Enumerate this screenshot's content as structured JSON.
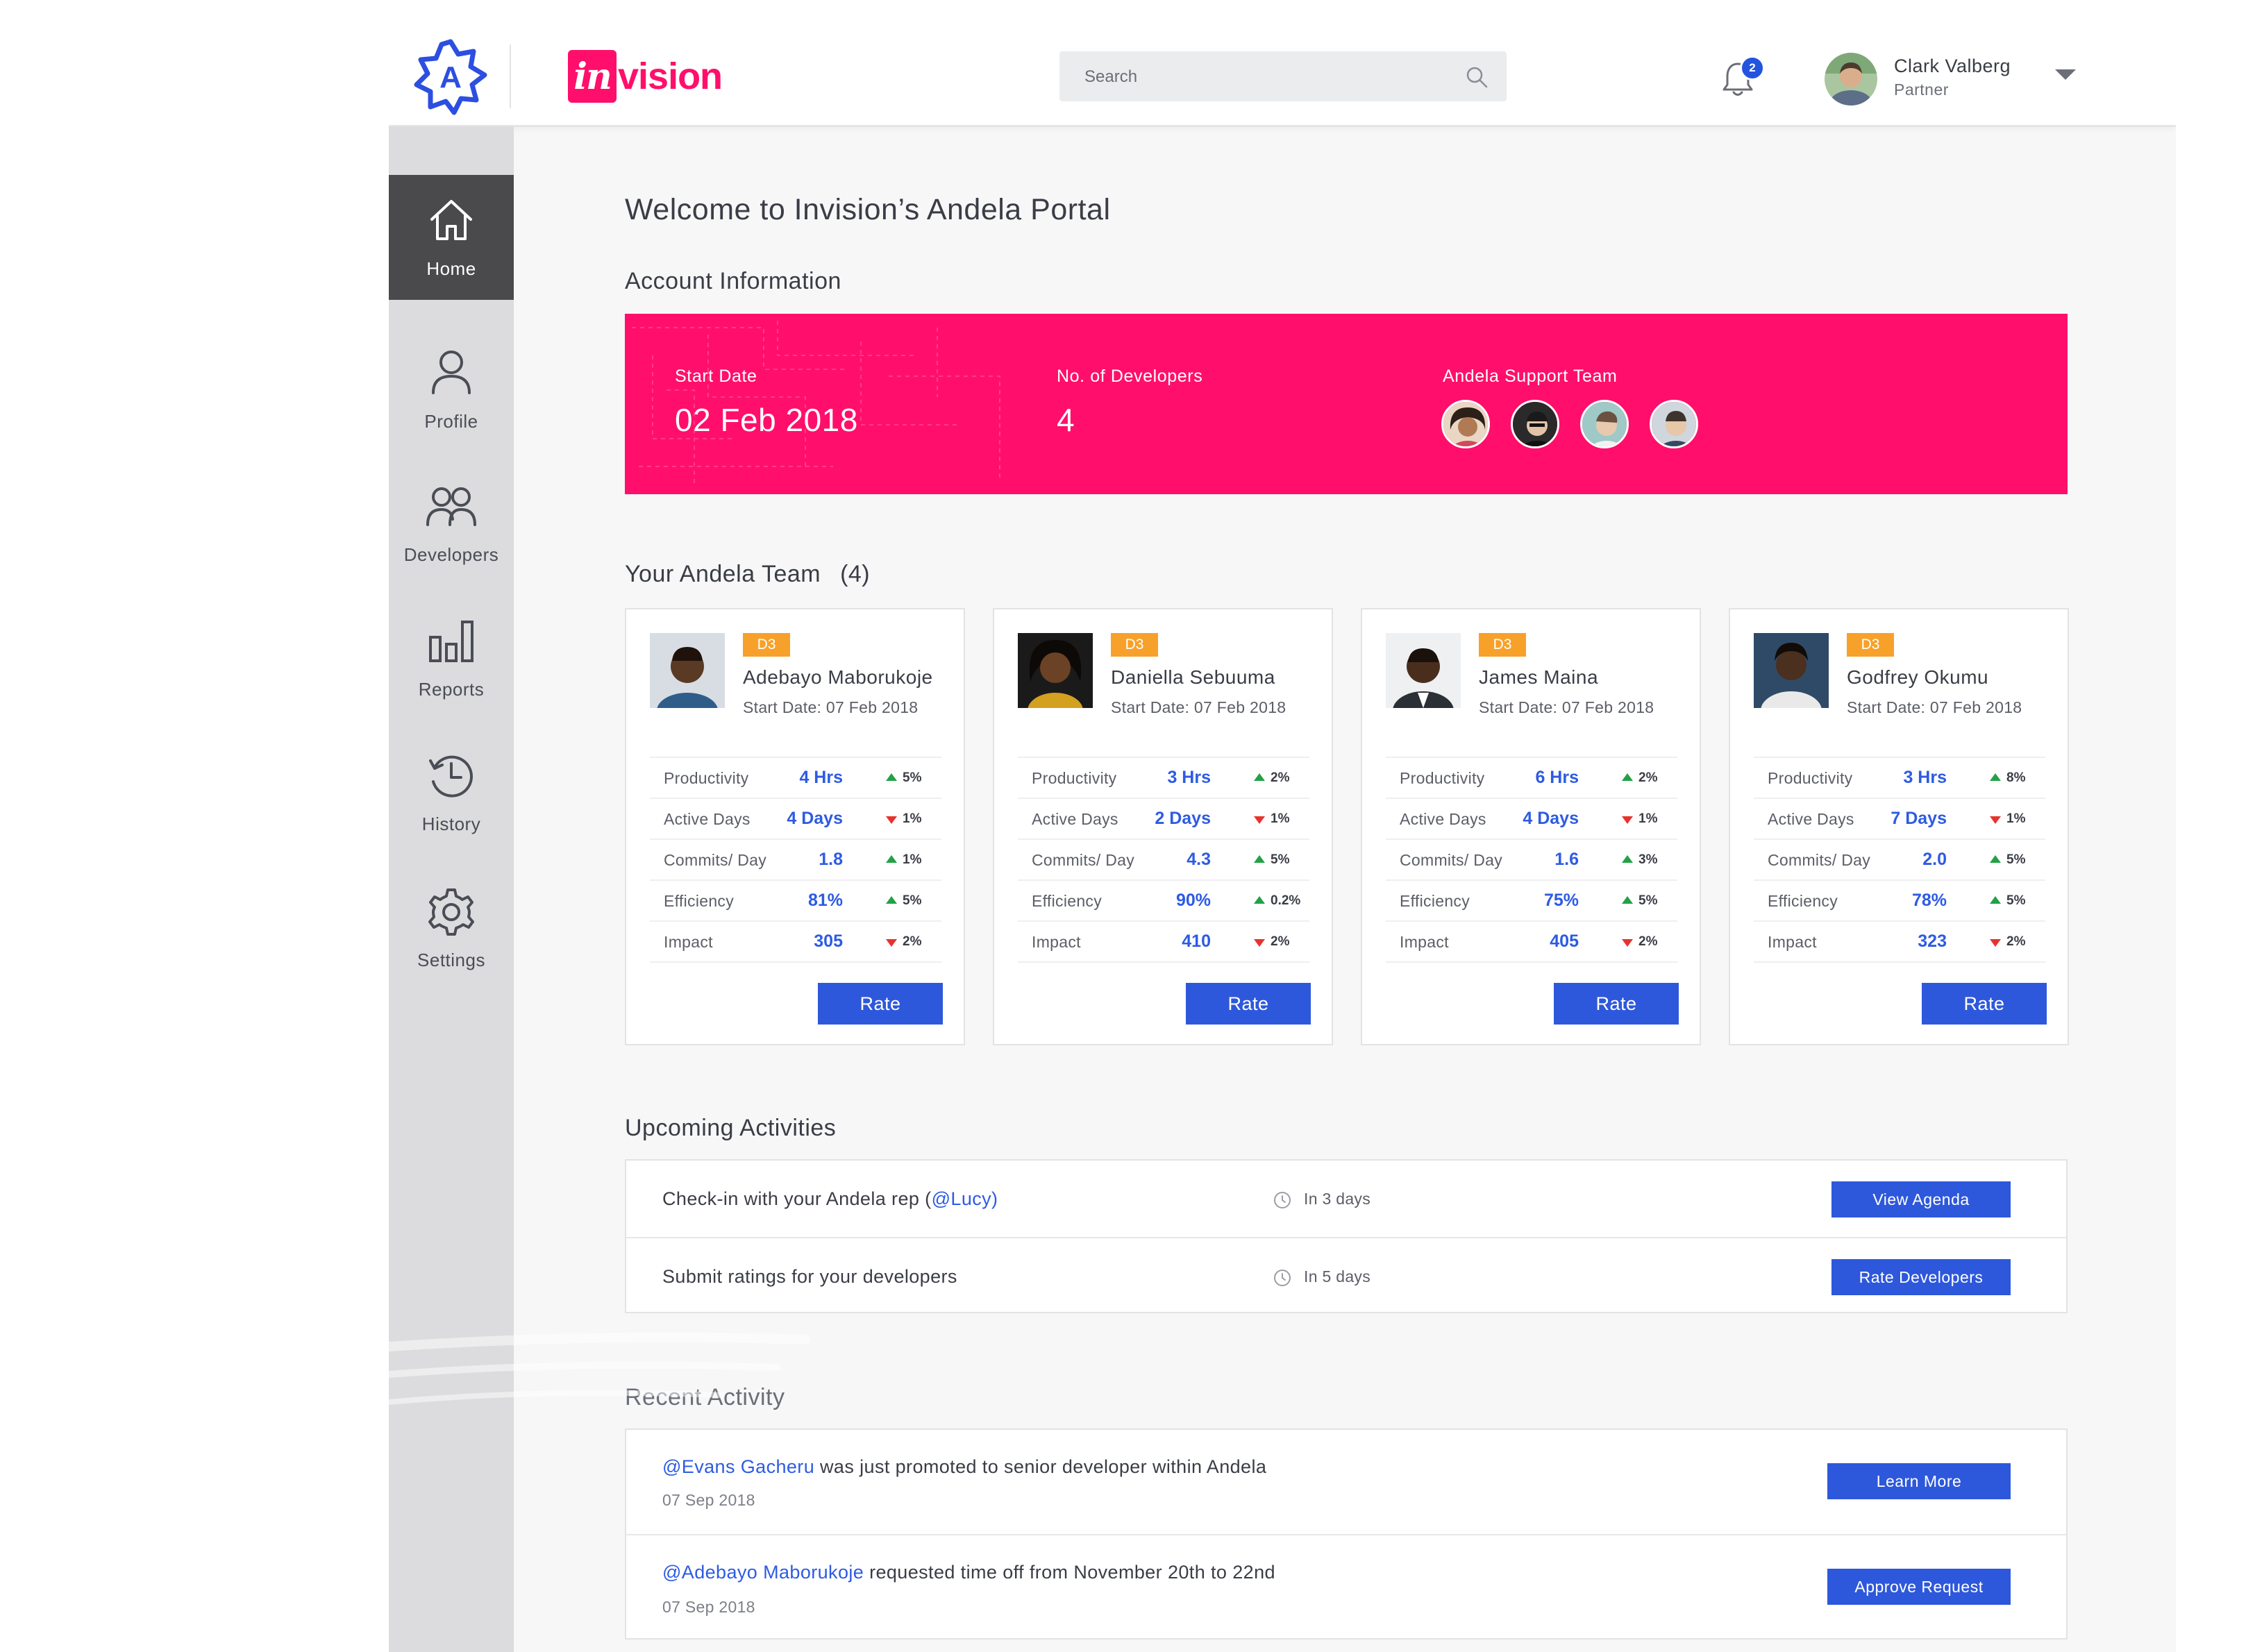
{
  "header": {
    "brand_logo_alt": "Andela",
    "partner_logo_main": "in",
    "partner_logo_rest": "vision",
    "search_placeholder": "Search",
    "notifications_count": "2",
    "user_name": "Clark Valberg",
    "user_role": "Partner"
  },
  "sidebar": {
    "items": [
      {
        "label": "Home",
        "icon": "home-icon",
        "active": true
      },
      {
        "label": "Profile",
        "icon": "profile-icon",
        "active": false
      },
      {
        "label": "Developers",
        "icon": "developers-icon",
        "active": false
      },
      {
        "label": "Reports",
        "icon": "reports-icon",
        "active": false
      },
      {
        "label": "History",
        "icon": "history-icon",
        "active": false
      },
      {
        "label": "Settings",
        "icon": "settings-icon",
        "active": false
      }
    ]
  },
  "main": {
    "welcome": "Welcome to Invision’s Andela Portal",
    "account_title": "Account Information",
    "account": {
      "start_date_label": "Start Date",
      "start_date": "02 Feb 2018",
      "developers_label": "No. of Developers",
      "developers_count": "4",
      "support_label": "Andela Support Team"
    },
    "team_title": "Your Andela Team",
    "team_count": "(4)",
    "metric_labels": [
      "Productivity",
      "Active Days",
      "Commits/ Day",
      "Efficiency",
      "Impact"
    ],
    "developers": [
      {
        "level": "D3",
        "name": "Adebayo Maborukoje",
        "start": "Start Date: 07 Feb 2018",
        "metrics": [
          {
            "value": "4 Hrs",
            "dir": "up",
            "change": "5%"
          },
          {
            "value": "4 Days",
            "dir": "down",
            "change": "1%"
          },
          {
            "value": "1.8",
            "dir": "up",
            "change": "1%"
          },
          {
            "value": "81%",
            "dir": "up",
            "change": "5%"
          },
          {
            "value": "305",
            "dir": "down",
            "change": "2%"
          }
        ],
        "rate_label": "Rate"
      },
      {
        "level": "D3",
        "name": "Daniella Sebuuma",
        "start": "Start Date: 07 Feb 2018",
        "metrics": [
          {
            "value": "3 Hrs",
            "dir": "up",
            "change": "2%"
          },
          {
            "value": "2 Days",
            "dir": "down",
            "change": "1%"
          },
          {
            "value": "4.3",
            "dir": "up",
            "change": "5%"
          },
          {
            "value": "90%",
            "dir": "up",
            "change": "0.2%"
          },
          {
            "value": "410",
            "dir": "down",
            "change": "2%"
          }
        ],
        "rate_label": "Rate"
      },
      {
        "level": "D3",
        "name": "James Maina",
        "start": "Start Date: 07 Feb 2018",
        "metrics": [
          {
            "value": "6 Hrs",
            "dir": "up",
            "change": "2%"
          },
          {
            "value": "4 Days",
            "dir": "down",
            "change": "1%"
          },
          {
            "value": "1.6",
            "dir": "up",
            "change": "3%"
          },
          {
            "value": "75%",
            "dir": "up",
            "change": "5%"
          },
          {
            "value": "405",
            "dir": "down",
            "change": "2%"
          }
        ],
        "rate_label": "Rate"
      },
      {
        "level": "D3",
        "name": "Godfrey Okumu",
        "start": "Start Date: 07 Feb 2018",
        "metrics": [
          {
            "value": "3 Hrs",
            "dir": "up",
            "change": "8%"
          },
          {
            "value": "7 Days",
            "dir": "down",
            "change": "1%"
          },
          {
            "value": "2.0",
            "dir": "up",
            "change": "5%"
          },
          {
            "value": "78%",
            "dir": "up",
            "change": "5%"
          },
          {
            "value": "323",
            "dir": "down",
            "change": "2%"
          }
        ],
        "rate_label": "Rate"
      }
    ],
    "upcoming_title": "Upcoming Activities",
    "upcoming": [
      {
        "text_before": "Check-in with your Andela rep (",
        "mention": "@Lucy",
        "text_after": ")",
        "when": "In 3 days",
        "button": "View Agenda"
      },
      {
        "text_before": "Submit ratings for your developers",
        "mention": "",
        "text_after": "",
        "when": "In 5 days",
        "button": "Rate Developers"
      }
    ],
    "recent_title": "Recent Activity",
    "recent": [
      {
        "mention": "@Evans Gacheru",
        "text": " was just promoted to senior developer within Andela",
        "date": "07 Sep 2018",
        "button": "Learn More"
      },
      {
        "mention": "@Adebayo Maborukoje",
        "text": " requested time off from November 20th to 22nd",
        "date": "07 Sep 2018",
        "button": "Approve Request"
      }
    ]
  },
  "colors": {
    "accent_pink": "#ff0f6b",
    "button_blue": "#2e58db",
    "link_blue": "#2d5be3",
    "badge_orange": "#f7a12b",
    "up_green": "#22a146",
    "down_red": "#e8322e"
  }
}
